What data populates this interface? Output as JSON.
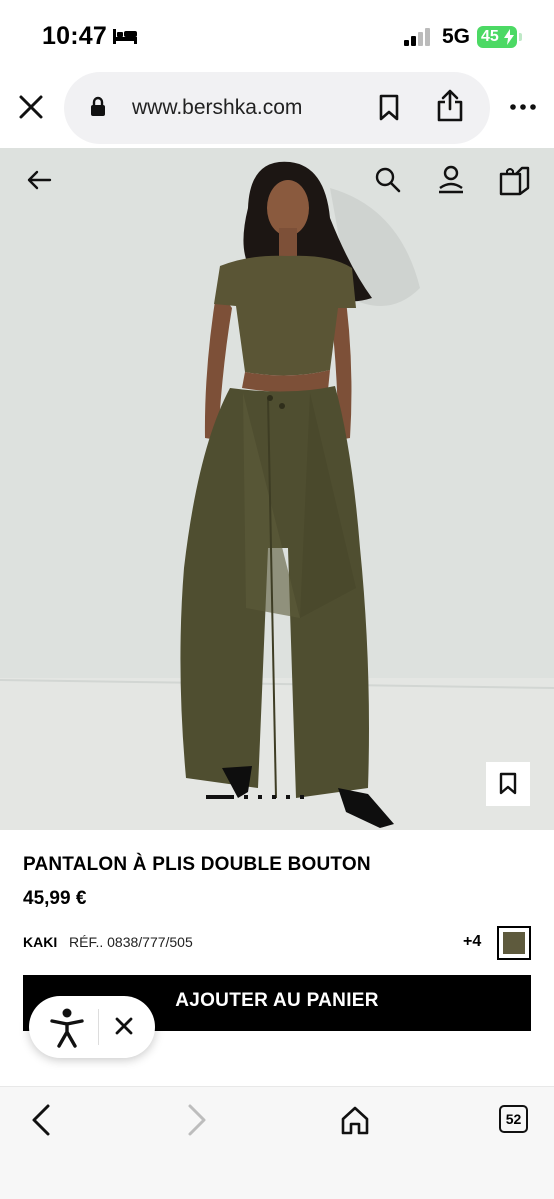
{
  "status_bar": {
    "time": "10:47",
    "network": "5G",
    "battery": "45"
  },
  "browser": {
    "url": "www.bershka.com"
  },
  "product": {
    "name": "PANTALON À PLIS DOUBLE BOUTON",
    "price": "45,99 €",
    "color": "KAKI",
    "reference": "RÉF.. 0838/777/505",
    "more_colors": "+4",
    "swatch_color": "#5e5a3d",
    "add_to_cart_label": "AJOUTER AU PANIER"
  },
  "gallery": {
    "current_slide": 1,
    "total_slides": 6
  },
  "toolbar": {
    "tab_count": "52"
  },
  "icons": [
    "bed-icon",
    "signal-icon",
    "close-icon",
    "lock-icon",
    "bookmark-icon",
    "share-icon",
    "more-icon",
    "back-arrow-icon",
    "search-icon",
    "account-icon",
    "bag-icon",
    "accessibility-icon",
    "chevron-left-icon",
    "chevron-right-icon",
    "home-icon",
    "tabs-icon"
  ]
}
